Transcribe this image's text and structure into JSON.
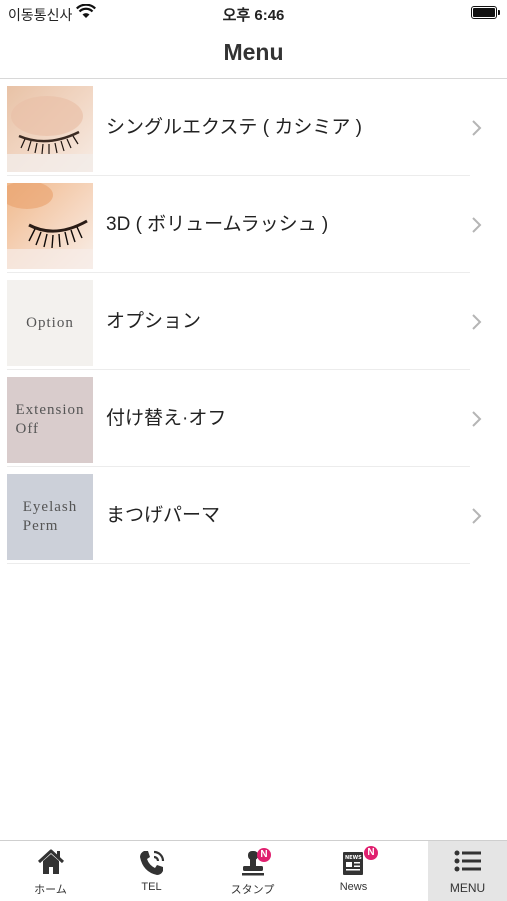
{
  "status_bar": {
    "carrier": "이동통신사",
    "time": "오후 6:46"
  },
  "nav": {
    "title": "Menu"
  },
  "menu_items": [
    {
      "label": "シングルエクステ ( カシミア )",
      "thumb_lines": []
    },
    {
      "label": "3D ( ボリュームラッシュ )",
      "thumb_lines": []
    },
    {
      "label": "オプション",
      "thumb_lines": [
        "Option"
      ],
      "thumb_bg": "#f3f1ee"
    },
    {
      "label": "付け替え·オフ",
      "thumb_lines": [
        "Extension",
        "Off"
      ],
      "thumb_bg": "#d9cccc"
    },
    {
      "label": "まつげパーマ",
      "thumb_lines": [
        "Eyelash",
        "Perm"
      ],
      "thumb_bg": "#ccd0d9"
    }
  ],
  "tabs": [
    {
      "label": "ホーム",
      "icon": "home-icon"
    },
    {
      "label": "TEL",
      "icon": "phone-icon"
    },
    {
      "label": "スタンプ",
      "icon": "stamp-icon",
      "badge": "N"
    },
    {
      "label": "News",
      "icon": "news-icon",
      "badge": "N",
      "badge_text": "NEWS"
    },
    {
      "label": "MENU",
      "icon": "menu-list-icon",
      "active": true
    }
  ],
  "colors": {
    "badge": "#e0206f",
    "active_tab_bg": "#e5e5e5"
  }
}
